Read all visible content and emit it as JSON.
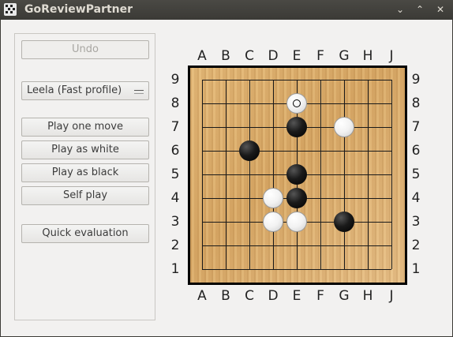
{
  "window": {
    "title": "GoReviewPartner",
    "controls": [
      "minimize-icon",
      "maximize-icon",
      "close-icon"
    ]
  },
  "panel": {
    "undo_label": "Undo",
    "engine_select": {
      "value": "Leela (Fast profile)"
    },
    "play_one_move_label": "Play one move",
    "play_as_white_label": "Play as white",
    "play_as_black_label": "Play as black",
    "self_play_label": "Self play",
    "quick_evaluation_label": "Quick evaluation"
  },
  "board": {
    "columns": [
      "A",
      "B",
      "C",
      "D",
      "E",
      "F",
      "G",
      "H",
      "J"
    ],
    "rows": [
      "9",
      "8",
      "7",
      "6",
      "5",
      "4",
      "3",
      "2",
      "1"
    ],
    "stones": [
      {
        "color": "white",
        "point": "E8",
        "last_move": true
      },
      {
        "color": "black",
        "point": "E7"
      },
      {
        "color": "white",
        "point": "G7"
      },
      {
        "color": "black",
        "point": "C6"
      },
      {
        "color": "black",
        "point": "E5"
      },
      {
        "color": "white",
        "point": "D4"
      },
      {
        "color": "black",
        "point": "E4"
      },
      {
        "color": "white",
        "point": "D3"
      },
      {
        "color": "white",
        "point": "E3"
      },
      {
        "color": "black",
        "point": "G3"
      }
    ]
  }
}
